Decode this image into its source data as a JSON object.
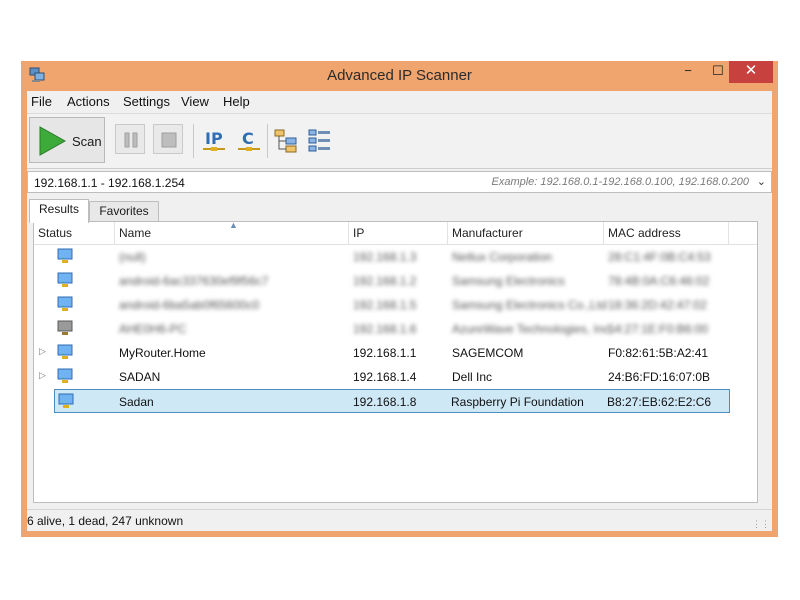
{
  "window": {
    "title": "Advanced IP Scanner",
    "close_glyph": "✕",
    "min_glyph": "−",
    "max_glyph": "☐"
  },
  "menu": [
    "File",
    "Actions",
    "Settings",
    "View",
    "Help"
  ],
  "toolbar": {
    "scan_label": "Scan"
  },
  "range": {
    "value": "192.168.1.1 - 192.168.1.254",
    "example": "Example: 192.168.0.1-192.168.0.100, 192.168.0.200"
  },
  "tabs": [
    "Results",
    "Favorites"
  ],
  "columns": [
    "Status",
    "Name",
    "IP",
    "Manufacturer",
    "MAC address"
  ],
  "rows": [
    {
      "name": "(null)",
      "ip": "192.168.1.3",
      "manufacturer": "Netlux Corporation",
      "mac": "28:C1:4F:0B:C4:53",
      "blurred": true
    },
    {
      "name": "android-6ac337630ef9f56c7",
      "ip": "192.168.1.2",
      "manufacturer": "Samsung Electronics",
      "mac": "78:4B:0A:C6:46:02",
      "blurred": true
    },
    {
      "name": "android-6ba5ab0f65600c0",
      "ip": "192.168.1.5",
      "manufacturer": "Samsung Electronics Co.,Ltd",
      "mac": "18:36:2D:42:47:02",
      "blurred": true
    },
    {
      "name": "AHE0H6-PC",
      "ip": "192.168.1.6",
      "manufacturer": "AzureWave Technologies, Inc.",
      "mac": "54:27:1E:F0:B6:00",
      "blurred": true
    },
    {
      "name": "MyRouter.Home",
      "ip": "192.168.1.1",
      "manufacturer": "SAGEMCOM",
      "mac": "F0:82:61:5B:A2:41",
      "blurred": false
    },
    {
      "name": "SADAN",
      "ip": "192.168.1.4",
      "manufacturer": "Dell Inc",
      "mac": "24:B6:FD:16:07:0B",
      "blurred": false
    },
    {
      "name": "Sadan",
      "ip": "192.168.1.8",
      "manufacturer": "Raspberry Pi Foundation",
      "mac": "B8:27:EB:62:E2:C6",
      "blurred": false
    }
  ],
  "status": {
    "text": "6 alive, 1 dead, 247 unknown"
  },
  "colors": {
    "frame": "#f0a46e",
    "close": "#c7413e",
    "selected_row": "#cfe8f6",
    "play_green": "#3dab3a",
    "icon_blue": "#2f6db5"
  }
}
